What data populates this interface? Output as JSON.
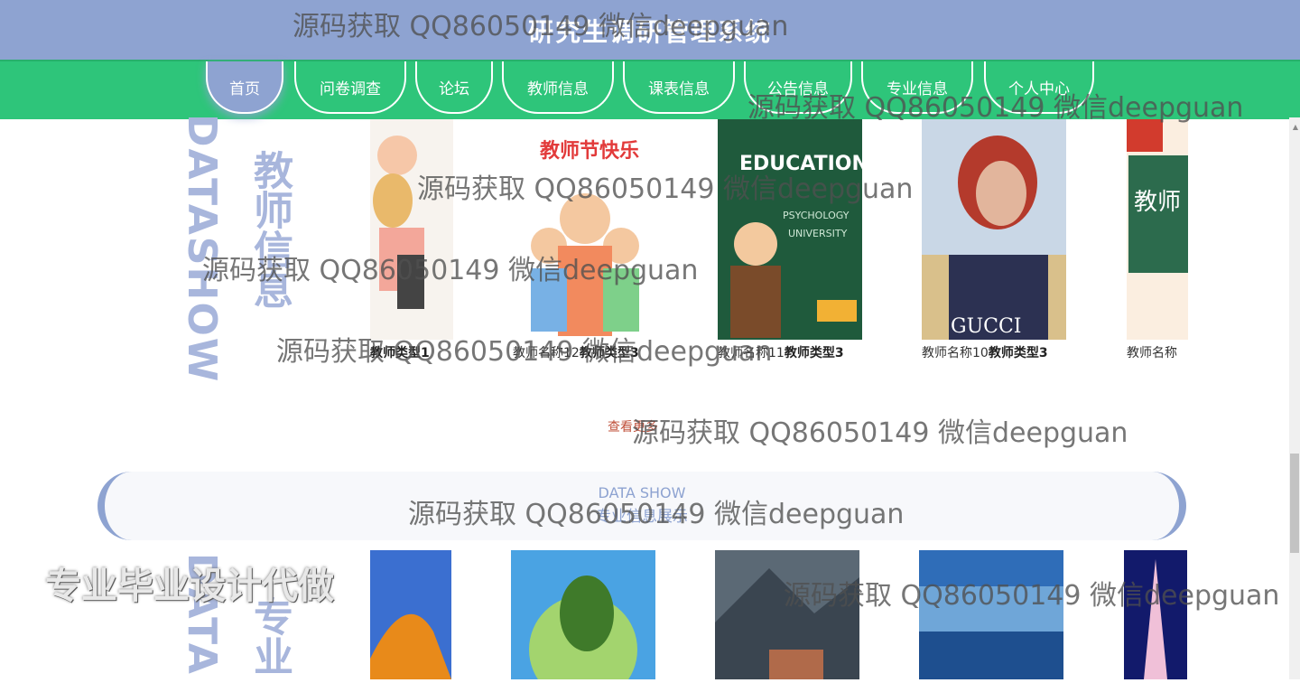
{
  "header": {
    "title": "研究生调研管理系统"
  },
  "nav": {
    "items": [
      "首页",
      "问卷调查",
      "论坛",
      "教师信息",
      "课表信息",
      "公告信息",
      "专业信息",
      "个人中心"
    ],
    "active_index": 0
  },
  "teacher_section": {
    "vertical_en": "DATASHOW",
    "vertical_zh": "教师信息",
    "cards": [
      {
        "name": "",
        "type": "教师类型1",
        "img": "person-illustration"
      },
      {
        "name": "教师名称12",
        "type": "教师类型3",
        "img": "teachers-day-cartoon"
      },
      {
        "name": "教师名称11",
        "type": "教师类型3",
        "img": "education-chalkboard-cartoon"
      },
      {
        "name": "教师名称10",
        "type": "教师类型3",
        "img": "woman-portrait"
      },
      {
        "name": "教师名称",
        "type": "",
        "img": "chalkboard-teacher"
      }
    ],
    "more_label": "查看更多"
  },
  "major_section": {
    "banner_en": "DATA SHOW",
    "banner_zh": "专业信息展示",
    "vertical_en": "DATA",
    "vertical_zh": "专业",
    "cards": [
      {
        "img": "orange-mountain"
      },
      {
        "img": "tree-globe"
      },
      {
        "img": "mountain-village"
      },
      {
        "img": "sea-water"
      },
      {
        "img": "eiffel-tower-night"
      }
    ]
  },
  "watermarks": [
    "源码获取 QQ86050149 微信deepguan",
    "源码获取 QQ86050149 微信deepguan",
    "源码获取 QQ86050149 微信deepguan",
    "源码获取 QQ86050149 微信deepguan",
    "源码获取 QQ86050149 微信deepguan",
    "源码获取 QQ86050149 微信deepguan",
    "源码获取 QQ86050149 微信deepguan",
    "源码获取 QQ86050149 微信deepguan"
  ],
  "promo_text": "专业毕业设计代做",
  "colors": {
    "header": "#8ea3d1",
    "nav": "#2ec57a",
    "accent": "#8ea3d1"
  }
}
